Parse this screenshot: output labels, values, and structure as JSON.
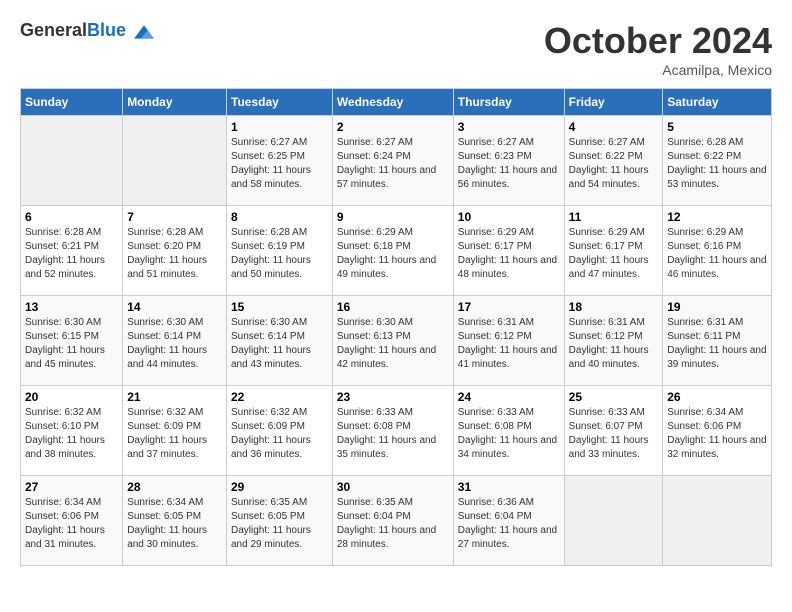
{
  "header": {
    "logo_general": "General",
    "logo_blue": "Blue",
    "month": "October 2024",
    "location": "Acamilpa, Mexico"
  },
  "days_of_week": [
    "Sunday",
    "Monday",
    "Tuesday",
    "Wednesday",
    "Thursday",
    "Friday",
    "Saturday"
  ],
  "weeks": [
    [
      {
        "day": "",
        "info": ""
      },
      {
        "day": "",
        "info": ""
      },
      {
        "day": "1",
        "info": "Sunrise: 6:27 AM\nSunset: 6:25 PM\nDaylight: 11 hours and 58 minutes."
      },
      {
        "day": "2",
        "info": "Sunrise: 6:27 AM\nSunset: 6:24 PM\nDaylight: 11 hours and 57 minutes."
      },
      {
        "day": "3",
        "info": "Sunrise: 6:27 AM\nSunset: 6:23 PM\nDaylight: 11 hours and 56 minutes."
      },
      {
        "day": "4",
        "info": "Sunrise: 6:27 AM\nSunset: 6:22 PM\nDaylight: 11 hours and 54 minutes."
      },
      {
        "day": "5",
        "info": "Sunrise: 6:28 AM\nSunset: 6:22 PM\nDaylight: 11 hours and 53 minutes."
      }
    ],
    [
      {
        "day": "6",
        "info": "Sunrise: 6:28 AM\nSunset: 6:21 PM\nDaylight: 11 hours and 52 minutes."
      },
      {
        "day": "7",
        "info": "Sunrise: 6:28 AM\nSunset: 6:20 PM\nDaylight: 11 hours and 51 minutes."
      },
      {
        "day": "8",
        "info": "Sunrise: 6:28 AM\nSunset: 6:19 PM\nDaylight: 11 hours and 50 minutes."
      },
      {
        "day": "9",
        "info": "Sunrise: 6:29 AM\nSunset: 6:18 PM\nDaylight: 11 hours and 49 minutes."
      },
      {
        "day": "10",
        "info": "Sunrise: 6:29 AM\nSunset: 6:17 PM\nDaylight: 11 hours and 48 minutes."
      },
      {
        "day": "11",
        "info": "Sunrise: 6:29 AM\nSunset: 6:17 PM\nDaylight: 11 hours and 47 minutes."
      },
      {
        "day": "12",
        "info": "Sunrise: 6:29 AM\nSunset: 6:16 PM\nDaylight: 11 hours and 46 minutes."
      }
    ],
    [
      {
        "day": "13",
        "info": "Sunrise: 6:30 AM\nSunset: 6:15 PM\nDaylight: 11 hours and 45 minutes."
      },
      {
        "day": "14",
        "info": "Sunrise: 6:30 AM\nSunset: 6:14 PM\nDaylight: 11 hours and 44 minutes."
      },
      {
        "day": "15",
        "info": "Sunrise: 6:30 AM\nSunset: 6:14 PM\nDaylight: 11 hours and 43 minutes."
      },
      {
        "day": "16",
        "info": "Sunrise: 6:30 AM\nSunset: 6:13 PM\nDaylight: 11 hours and 42 minutes."
      },
      {
        "day": "17",
        "info": "Sunrise: 6:31 AM\nSunset: 6:12 PM\nDaylight: 11 hours and 41 minutes."
      },
      {
        "day": "18",
        "info": "Sunrise: 6:31 AM\nSunset: 6:12 PM\nDaylight: 11 hours and 40 minutes."
      },
      {
        "day": "19",
        "info": "Sunrise: 6:31 AM\nSunset: 6:11 PM\nDaylight: 11 hours and 39 minutes."
      }
    ],
    [
      {
        "day": "20",
        "info": "Sunrise: 6:32 AM\nSunset: 6:10 PM\nDaylight: 11 hours and 38 minutes."
      },
      {
        "day": "21",
        "info": "Sunrise: 6:32 AM\nSunset: 6:09 PM\nDaylight: 11 hours and 37 minutes."
      },
      {
        "day": "22",
        "info": "Sunrise: 6:32 AM\nSunset: 6:09 PM\nDaylight: 11 hours and 36 minutes."
      },
      {
        "day": "23",
        "info": "Sunrise: 6:33 AM\nSunset: 6:08 PM\nDaylight: 11 hours and 35 minutes."
      },
      {
        "day": "24",
        "info": "Sunrise: 6:33 AM\nSunset: 6:08 PM\nDaylight: 11 hours and 34 minutes."
      },
      {
        "day": "25",
        "info": "Sunrise: 6:33 AM\nSunset: 6:07 PM\nDaylight: 11 hours and 33 minutes."
      },
      {
        "day": "26",
        "info": "Sunrise: 6:34 AM\nSunset: 6:06 PM\nDaylight: 11 hours and 32 minutes."
      }
    ],
    [
      {
        "day": "27",
        "info": "Sunrise: 6:34 AM\nSunset: 6:06 PM\nDaylight: 11 hours and 31 minutes."
      },
      {
        "day": "28",
        "info": "Sunrise: 6:34 AM\nSunset: 6:05 PM\nDaylight: 11 hours and 30 minutes."
      },
      {
        "day": "29",
        "info": "Sunrise: 6:35 AM\nSunset: 6:05 PM\nDaylight: 11 hours and 29 minutes."
      },
      {
        "day": "30",
        "info": "Sunrise: 6:35 AM\nSunset: 6:04 PM\nDaylight: 11 hours and 28 minutes."
      },
      {
        "day": "31",
        "info": "Sunrise: 6:36 AM\nSunset: 6:04 PM\nDaylight: 11 hours and 27 minutes."
      },
      {
        "day": "",
        "info": ""
      },
      {
        "day": "",
        "info": ""
      }
    ]
  ]
}
